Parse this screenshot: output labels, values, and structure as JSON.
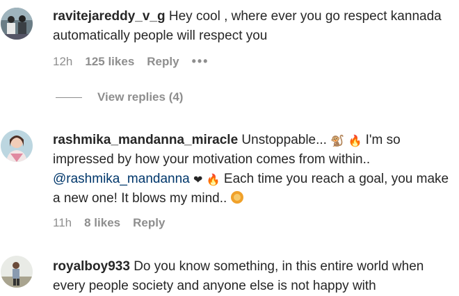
{
  "comments": [
    {
      "username": "ravitejareddy_v_g",
      "text": "Hey cool , where ever you go respect kannada automatically people will respect you",
      "time": "12h",
      "likes": "125 likes",
      "reply": "Reply",
      "more": "•••",
      "view_replies": "View replies (4)"
    },
    {
      "username": "rashmika_mandanna_miracle",
      "text_1": "Unstoppable...",
      "text_2": "I'm so impressed by how your motivation comes from within..",
      "mention": "@rashmika_mandanna",
      "text_3": "Each time you reach a goal, you make a new one! It blows my mind..",
      "time": "11h",
      "likes": "8 likes",
      "reply": "Reply"
    },
    {
      "username": "royalboy933",
      "text": "Do you know something, in this entire world when every people society and anyone else is not happy with"
    }
  ]
}
